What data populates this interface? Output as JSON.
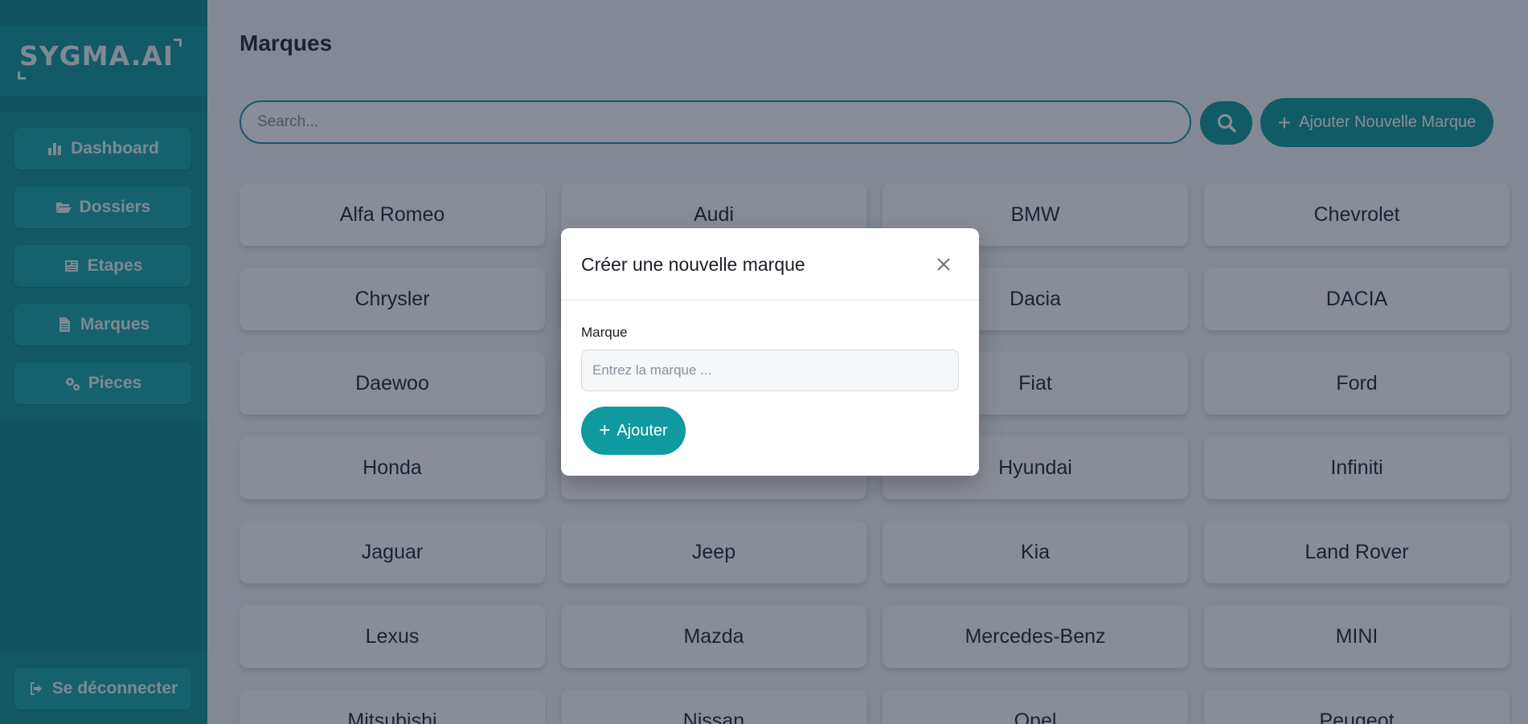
{
  "app": {
    "logo_text": "SYGMA.AI"
  },
  "sidebar": {
    "items": [
      {
        "label": "Dashboard",
        "icon": "chart-bar-icon"
      },
      {
        "label": "Dossiers",
        "icon": "folder-open-icon"
      },
      {
        "label": "Etapes",
        "icon": "newspaper-icon"
      },
      {
        "label": "Marques",
        "icon": "file-icon"
      },
      {
        "label": "Pieces",
        "icon": "gears-icon"
      }
    ],
    "logout_label": "Se déconnecter",
    "logout_icon": "sign-out-icon"
  },
  "main": {
    "title": "Marques",
    "search_placeholder": "Search...",
    "add_button_label": "Ajouter Nouvelle Marque",
    "brands": [
      "Alfa Romeo",
      "Audi",
      "BMW",
      "Chevrolet",
      "Chrysler",
      "",
      "Dacia",
      "DACIA",
      "Daewoo",
      "",
      "Fiat",
      "Ford",
      "Honda",
      "",
      "Hyundai",
      "Infiniti",
      "Jaguar",
      "Jeep",
      "Kia",
      "Land Rover",
      "Lexus",
      "Mazda",
      "Mercedes-Benz",
      "MINI",
      "Mitsubishi",
      "Nissan",
      "Opel",
      "Peugeot"
    ]
  },
  "modal": {
    "title": "Créer une nouvelle marque",
    "field_label": "Marque",
    "field_placeholder": "Entrez la marque ...",
    "field_value": "",
    "submit_label": "Ajouter"
  },
  "colors": {
    "accent": "#0e9a9f",
    "sidebar": "#0c8a8f",
    "overlay": "rgba(19, 28, 48, 0.5)"
  }
}
